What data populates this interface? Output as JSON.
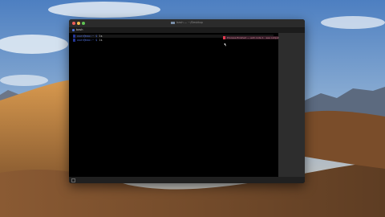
{
  "window": {
    "title": "bash — ~/Desktop"
  },
  "tab": {
    "label": "bash"
  },
  "terminal": {
    "lines": [
      {
        "number": "1",
        "prompt": "user@mac:~ $",
        "command": " ls"
      },
      {
        "number": "2",
        "prompt": "user@mac:~ $",
        "command": " ls"
      }
    ]
  },
  "notification": {
    "text": "Process finished — exit code 1 · see output"
  }
}
